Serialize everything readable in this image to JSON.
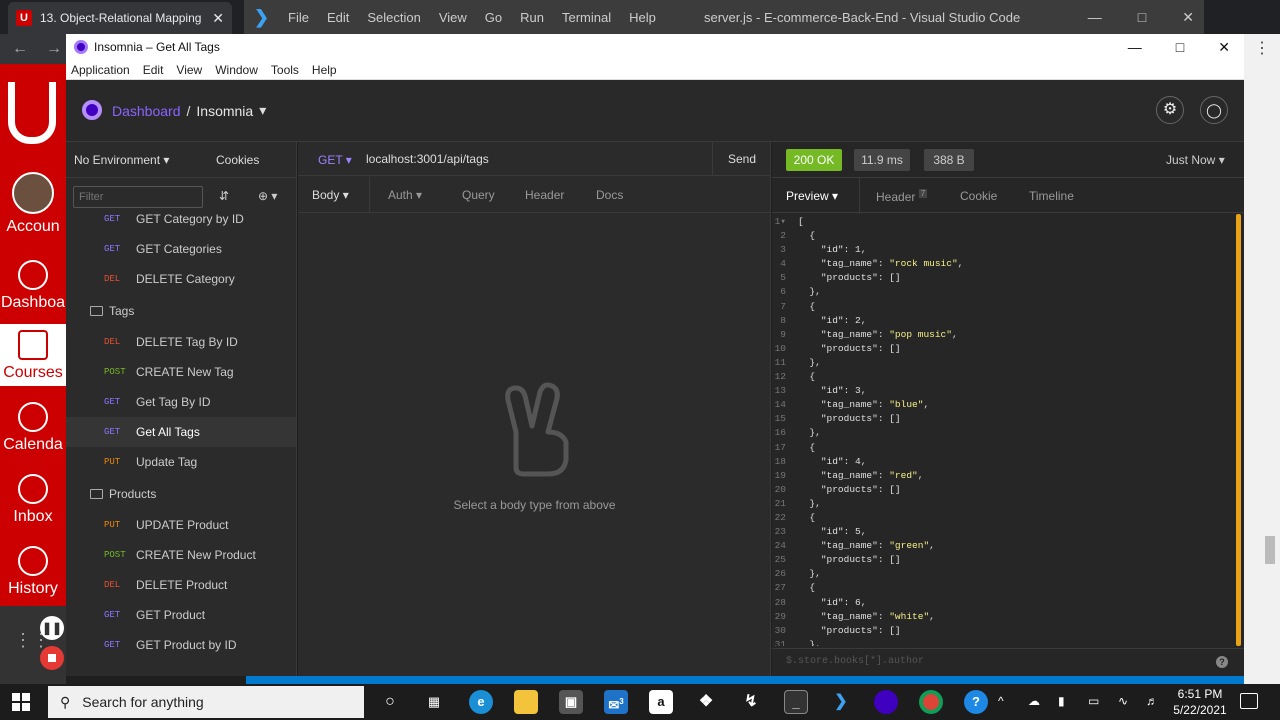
{
  "browser": {
    "tab_title": "13. Object-Relational Mapping (C",
    "tab_close": "✕",
    "favicon_letter": "U",
    "menu_icon": "⋮"
  },
  "vscode": {
    "menu": [
      "File",
      "Edit",
      "Selection",
      "View",
      "Go",
      "Run",
      "Terminal",
      "Help"
    ],
    "title": "server.js - E-commerce-Back-End - Visual Studio Code"
  },
  "site_nav": [
    {
      "label": "Accoun",
      "icon": "avatar-icon"
    },
    {
      "label": "Dashboa",
      "icon": "dashboard-icon"
    },
    {
      "label": "Courses",
      "icon": "book-icon"
    },
    {
      "label": "Calenda",
      "icon": "calendar-icon"
    },
    {
      "label": "Inbox",
      "icon": "inbox-icon"
    },
    {
      "label": "History",
      "icon": "clock-icon"
    }
  ],
  "insomnia": {
    "window_title": "Insomnia – Get All Tags",
    "menu": [
      "Application",
      "Edit",
      "View",
      "Window",
      "Tools",
      "Help"
    ],
    "breadcrumb": {
      "dashboard": "Dashboard",
      "separator": "/",
      "workspace": "Insomnia"
    },
    "environment": "No Environment",
    "cookies": "Cookies",
    "filter_placeholder": "Filter",
    "sidebar_items": [
      {
        "type": "request",
        "method": "GET",
        "name": "GET Category by ID",
        "color": "#8d73ff"
      },
      {
        "type": "request",
        "method": "GET",
        "name": "GET Categories",
        "color": "#8d73ff"
      },
      {
        "type": "request",
        "method": "DEL",
        "name": "DELETE Category",
        "color": "#e5502f"
      },
      {
        "type": "folder",
        "name": "Tags"
      },
      {
        "type": "request",
        "method": "DEL",
        "name": "DELETE Tag By ID",
        "color": "#e5502f"
      },
      {
        "type": "request",
        "method": "POST",
        "name": "CREATE New Tag",
        "color": "#75ba24"
      },
      {
        "type": "request",
        "method": "GET",
        "name": "Get Tag By ID",
        "color": "#8d73ff"
      },
      {
        "type": "request",
        "method": "GET",
        "name": "Get All Tags",
        "color": "#8d73ff",
        "active": true
      },
      {
        "type": "request",
        "method": "PUT",
        "name": "Update Tag",
        "color": "#ec8702"
      },
      {
        "type": "folder",
        "name": "Products"
      },
      {
        "type": "request",
        "method": "PUT",
        "name": "UPDATE Product",
        "color": "#ec8702"
      },
      {
        "type": "request",
        "method": "POST",
        "name": "CREATE New Product",
        "color": "#75ba24"
      },
      {
        "type": "request",
        "method": "DEL",
        "name": "DELETE Product",
        "color": "#e5502f"
      },
      {
        "type": "request",
        "method": "GET",
        "name": "GET Product",
        "color": "#8d73ff"
      },
      {
        "type": "request",
        "method": "GET",
        "name": "GET Product by ID",
        "color": "#8d73ff"
      }
    ],
    "request": {
      "method": "GET",
      "url": "localhost:3001/api/tags",
      "send": "Send",
      "tabs": [
        "Body",
        "Auth",
        "Query",
        "Header",
        "Docs"
      ],
      "empty_message": "Select a body type from above"
    },
    "response": {
      "status": "200 OK",
      "time": "11.9 ms",
      "size": "388 B",
      "when": "Just Now",
      "tabs": [
        "Preview",
        "Header",
        "Cookie",
        "Timeline"
      ],
      "header_count": "7",
      "filter_placeholder": "$.store.books[*].author",
      "help": "?",
      "tags": [
        {
          "id": 1,
          "tag_name": "rock music"
        },
        {
          "id": 2,
          "tag_name": "pop music"
        },
        {
          "id": 3,
          "tag_name": "blue"
        },
        {
          "id": 4,
          "tag_name": "red"
        },
        {
          "id": 5,
          "tag_name": "green"
        },
        {
          "id": 6,
          "tag_name": "white"
        }
      ]
    }
  },
  "taskbar": {
    "search": "Search for anything",
    "time": "6:51 PM",
    "date": "5/22/2021",
    "mail_badge": "3"
  }
}
